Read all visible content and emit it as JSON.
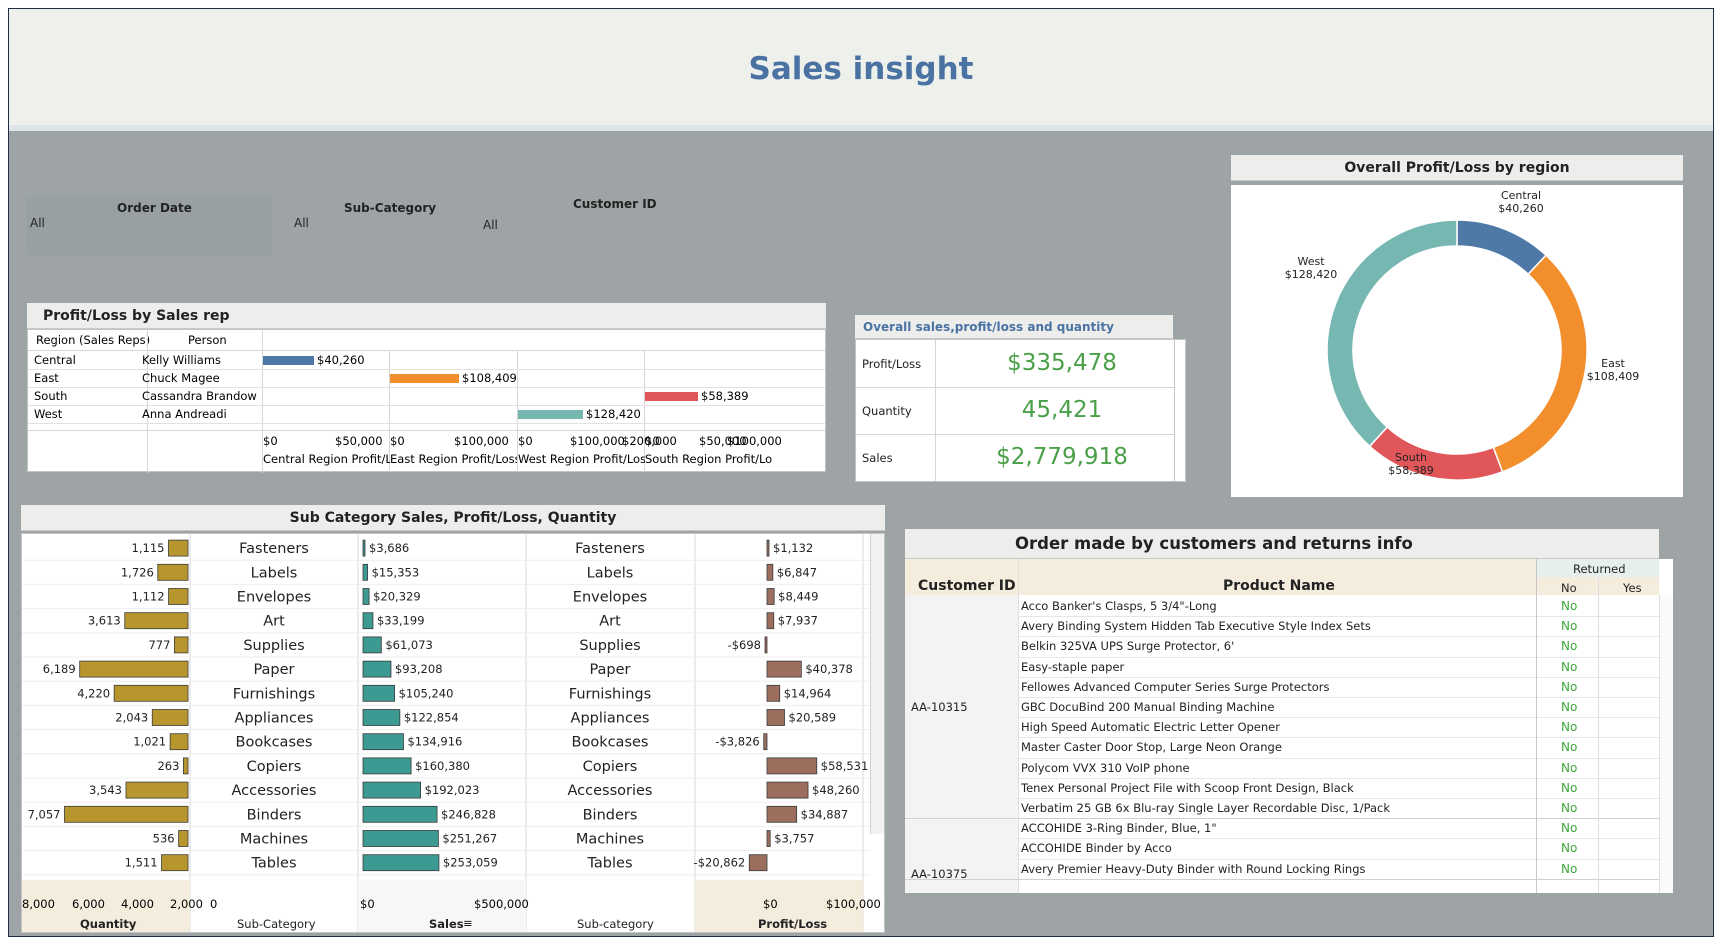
{
  "title": "Sales insight",
  "filters": {
    "order_date": {
      "label": "Order Date",
      "value": "All"
    },
    "sub_category": {
      "label": "Sub-Category",
      "value": "All"
    },
    "customer_id": {
      "label": "Customer ID",
      "value": "All"
    }
  },
  "sales_rep": {
    "title": "Profit/Loss by Sales rep",
    "col_region": "Region (Sales Reps)",
    "col_person": "Person",
    "rows": [
      {
        "region": "Central",
        "person": "Kelly Williams",
        "value": 40260,
        "label": "$40,260",
        "color": "#4e79a7"
      },
      {
        "region": "East",
        "person": "Chuck Magee",
        "value": 108409,
        "label": "$108,409",
        "color": "#f28e2b"
      },
      {
        "region": "South",
        "person": "Cassandra Brandow",
        "value": 58389,
        "label": "$58,389",
        "color": "#e15759"
      },
      {
        "region": "West",
        "person": "Anna Andreadi",
        "value": 128420,
        "label": "$128,420",
        "color": "#76b7b2"
      }
    ],
    "axes": [
      {
        "ticks": [
          "$0",
          "$50,000"
        ],
        "label": "Central  Region Profit/Lo.."
      },
      {
        "ticks": [
          "$0",
          "$100,000"
        ],
        "label": "East Region Profit/Loss"
      },
      {
        "ticks": [
          "$0",
          "$100,000",
          "$200,000"
        ],
        "label": "West Region Profit/Loss"
      },
      {
        "ticks": [
          "$0",
          "$50,000",
          "$100,000"
        ],
        "label": "South Region Profit/Loss"
      }
    ]
  },
  "kpi": {
    "title": "Overall sales,profit/loss and quantity",
    "items": [
      {
        "label": "Profit/Loss",
        "value": "$335,478"
      },
      {
        "label": "Quantity",
        "value": "45,421"
      },
      {
        "label": "Sales",
        "value": "$2,779,918"
      }
    ]
  },
  "donut": {
    "title": "Overall Profit/Loss by region",
    "slices": [
      {
        "name": "Central",
        "value": 40260,
        "label": "$40,260",
        "color": "#4e79a7"
      },
      {
        "name": "East",
        "value": 108409,
        "label": "$108,409",
        "color": "#f28e2b"
      },
      {
        "name": "South",
        "value": 58389,
        "label": "$58,389",
        "color": "#e15759"
      },
      {
        "name": "West",
        "value": 128420,
        "label": "$128,420",
        "color": "#76b7b2"
      }
    ]
  },
  "sub_category": {
    "title": "Sub Category Sales, Profit/Loss, Quantity",
    "footer": {
      "quantity": "Quantity",
      "sub1": "Sub-Category",
      "sales": "Sales",
      "sub2": "Sub-category",
      "profit": "Profit/Loss"
    },
    "quantity_ticks": [
      "8,000",
      "6,000",
      "4,000",
      "2,000",
      "0"
    ],
    "sales_ticks": [
      "$0",
      "$500,000"
    ],
    "profit_ticks": [
      "$0",
      "$100,000"
    ]
  },
  "chart_data": {
    "type": "bar",
    "categories": [
      "Fasteners",
      "Labels",
      "Envelopes",
      "Art",
      "Supplies",
      "Paper",
      "Furnishings",
      "Appliances",
      "Bookcases",
      "Copiers",
      "Accessories",
      "Binders",
      "Machines",
      "Tables"
    ],
    "series": [
      {
        "name": "Quantity",
        "values": [
          1115,
          1726,
          1112,
          3613,
          777,
          6189,
          4220,
          2043,
          1021,
          263,
          3543,
          7057,
          536,
          1511
        ],
        "labels": [
          "1,115",
          "1,726",
          "1,112",
          "3,613",
          "777",
          "6,189",
          "4,220",
          "2,043",
          "1,021",
          "263",
          "3,543",
          "7,057",
          "536",
          "1,511"
        ],
        "color": "#b8962e"
      },
      {
        "name": "Sales",
        "values": [
          3686,
          15353,
          20329,
          33199,
          61073,
          93208,
          105240,
          122854,
          134916,
          160380,
          192023,
          246828,
          251267,
          253059
        ],
        "labels": [
          "$3,686",
          "$15,353",
          "$20,329",
          "$33,199",
          "$61,073",
          "$93,208",
          "$105,240",
          "$122,854",
          "$134,916",
          "$160,380",
          "$192,023",
          "$246,828",
          "$251,267",
          "$253,059"
        ],
        "color": "#3c9a92"
      },
      {
        "name": "Profit/Loss",
        "values": [
          1132,
          6847,
          8449,
          7937,
          -698,
          40378,
          14964,
          20589,
          -3826,
          58531,
          48260,
          34887,
          3757,
          -20862
        ],
        "labels": [
          "$1,132",
          "$6,847",
          "$8,449",
          "$7,937",
          "-$698",
          "$40,378",
          "$14,964",
          "$20,589",
          "-$3,826",
          "$58,531",
          "$48,260",
          "$34,887",
          "$3,757",
          "-$20,862"
        ],
        "color": "#9b6e5e"
      }
    ],
    "quantity_xlim": [
      0,
      8000
    ],
    "sales_xlim": [
      0,
      500000
    ],
    "profit_xlim": [
      -25000,
      100000
    ]
  },
  "orders": {
    "title": "Order made by customers and returns info",
    "col_customer": "Customer ID",
    "col_product": "Product Name",
    "col_returned": "Returned",
    "col_no": "No",
    "col_yes": "Yes",
    "groups": [
      {
        "customer": "AA-10315",
        "products": [
          {
            "name": "Acco Banker's Clasps, 5 3/4\"-Long",
            "no": "No"
          },
          {
            "name": "Avery Binding System Hidden Tab Executive Style Index Sets",
            "no": "No"
          },
          {
            "name": "Belkin 325VA UPS Surge Protector, 6'",
            "no": "No"
          },
          {
            "name": "Easy-staple paper",
            "no": "No"
          },
          {
            "name": "Fellowes Advanced Computer Series Surge Protectors",
            "no": "No"
          },
          {
            "name": "GBC DocuBind 200 Manual Binding Machine",
            "no": "No"
          },
          {
            "name": "High Speed Automatic Electric Letter Opener",
            "no": "No"
          },
          {
            "name": "Master Caster Door Stop, Large Neon Orange",
            "no": "No"
          },
          {
            "name": "Polycom VVX 310 VoIP phone",
            "no": "No"
          },
          {
            "name": "Tenex Personal Project File with Scoop Front Design, Black",
            "no": "No"
          },
          {
            "name": "Verbatim 25 GB 6x Blu-ray Single Layer Recordable Disc, 1/Pack",
            "no": "No"
          }
        ]
      },
      {
        "customer": "AA-10375",
        "products": [
          {
            "name": "ACCOHIDE 3-Ring Binder, Blue, 1\"",
            "no": "No"
          },
          {
            "name": "ACCOHIDE Binder by Acco",
            "no": "No"
          },
          {
            "name": "Avery Premier Heavy-Duty Binder with Round Locking Rings",
            "no": "No"
          }
        ]
      }
    ]
  }
}
